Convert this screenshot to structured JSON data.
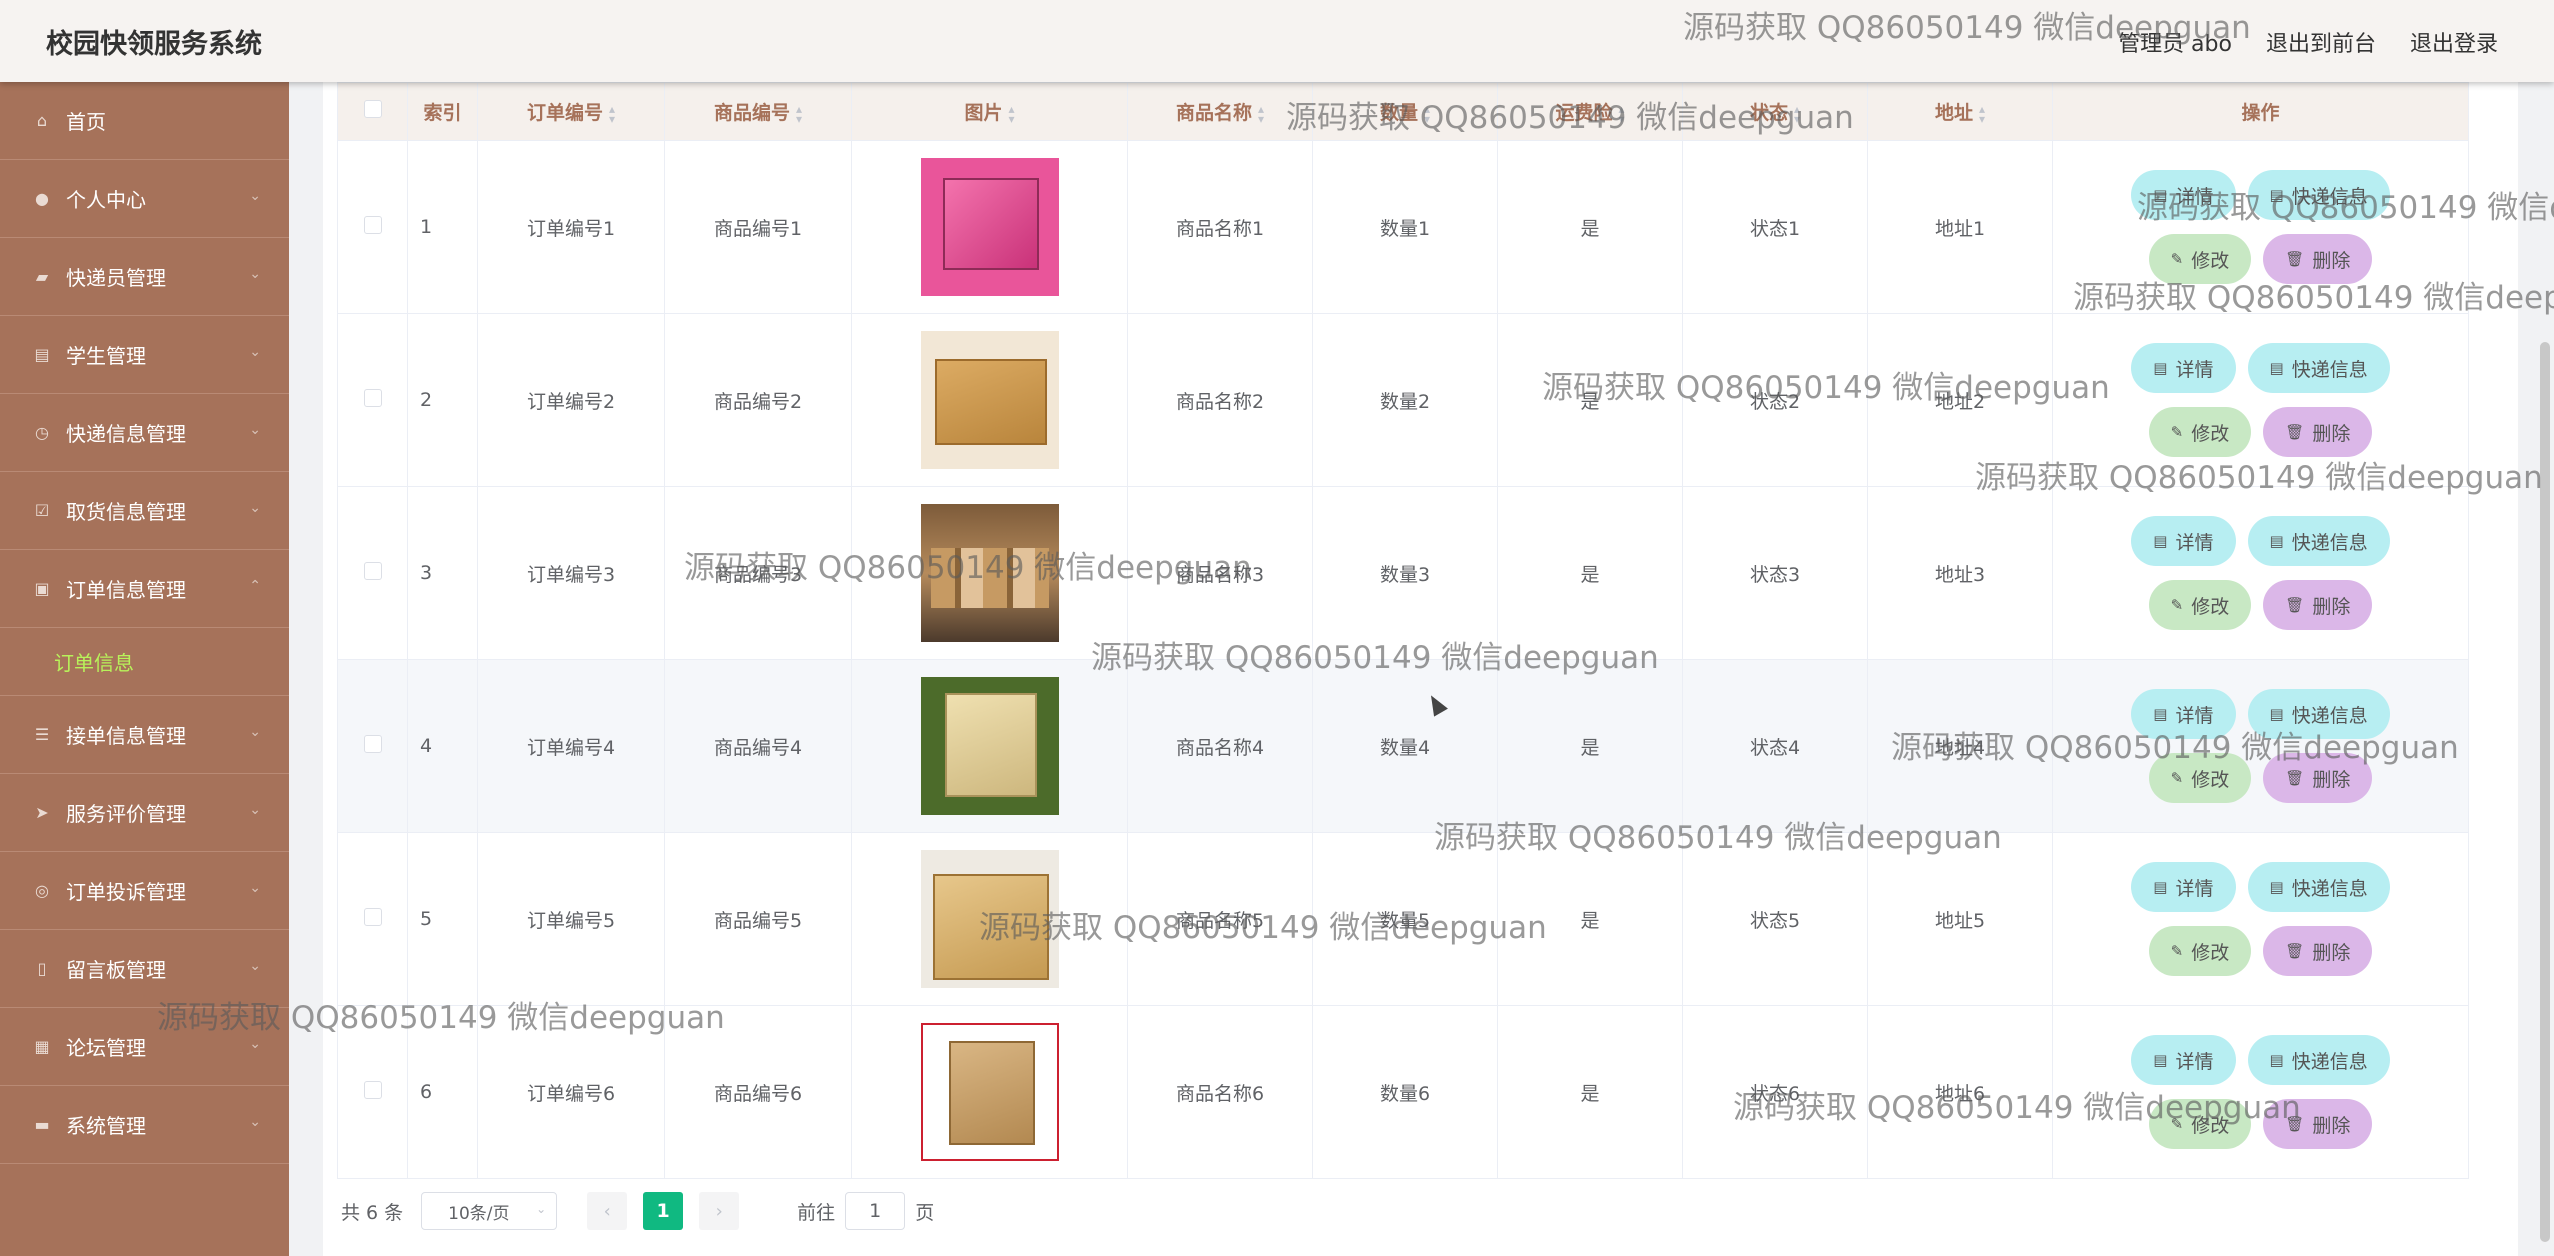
{
  "header": {
    "app_title": "校园快领服务系统",
    "links": [
      "管理员 abo",
      "退出到前台",
      "退出登录"
    ]
  },
  "sidebar": {
    "items": [
      {
        "label": "首页",
        "icon": "home-icon"
      },
      {
        "label": "个人中心",
        "icon": "user-icon"
      },
      {
        "label": "快递员管理",
        "icon": "courier-icon"
      },
      {
        "label": "学生管理",
        "icon": "student-icon"
      },
      {
        "label": "快递信息管理",
        "icon": "info-icon"
      },
      {
        "label": "取货信息管理",
        "icon": "pickup-icon"
      },
      {
        "label": "订单信息管理",
        "icon": "order-icon",
        "expanded": true
      },
      {
        "label": "接单信息管理",
        "icon": "accept-icon"
      },
      {
        "label": "服务评价管理",
        "icon": "review-icon"
      },
      {
        "label": "订单投诉管理",
        "icon": "complaint-icon"
      },
      {
        "label": "留言板管理",
        "icon": "message-icon"
      },
      {
        "label": "论坛管理",
        "icon": "forum-icon"
      },
      {
        "label": "系统管理",
        "icon": "system-icon"
      }
    ],
    "active_sub": "订单信息"
  },
  "table": {
    "headers": [
      "索引",
      "订单编号",
      "商品编号",
      "图片",
      "商品名称",
      "数量",
      "运费险",
      "状态",
      "地址",
      "操作"
    ],
    "rows": [
      {
        "index": "1",
        "order_no": "订单编号1",
        "goods_no": "商品编号1",
        "name": "商品名称1",
        "qty": "数量1",
        "insurance": "是",
        "status": "状态1",
        "address": "地址1"
      },
      {
        "index": "2",
        "order_no": "订单编号2",
        "goods_no": "商品编号2",
        "name": "商品名称2",
        "qty": "数量2",
        "insurance": "是",
        "status": "状态2",
        "address": "地址2"
      },
      {
        "index": "3",
        "order_no": "订单编号3",
        "goods_no": "商品编号3",
        "name": "商品名称3",
        "qty": "数量3",
        "insurance": "是",
        "status": "状态3",
        "address": "地址3"
      },
      {
        "index": "4",
        "order_no": "订单编号4",
        "goods_no": "商品编号4",
        "name": "商品名称4",
        "qty": "数量4",
        "insurance": "是",
        "status": "状态4",
        "address": "地址4"
      },
      {
        "index": "5",
        "order_no": "订单编号5",
        "goods_no": "商品编号5",
        "name": "商品名称5",
        "qty": "数量5",
        "insurance": "是",
        "status": "状态5",
        "address": "地址5"
      },
      {
        "index": "6",
        "order_no": "订单编号6",
        "goods_no": "商品编号6",
        "name": "商品名称6",
        "qty": "数量6",
        "insurance": "是",
        "status": "状态6",
        "address": "地址6"
      }
    ],
    "actions": {
      "detail": "详情",
      "express": "快递信息",
      "edit": "修改",
      "delete": "删除"
    }
  },
  "pagination": {
    "total": "共 6 条",
    "page_size": "10条/页",
    "current": "1",
    "goto_prefix": "前往",
    "goto_value": "1",
    "goto_suffix": "页"
  },
  "watermark": "源码获取 QQ86050149 微信deepguan",
  "colors": {
    "sidebar": "#a6725a",
    "accent": "#10b981",
    "submenu_active": "#b8f25a",
    "header_text": "#a6725a"
  }
}
